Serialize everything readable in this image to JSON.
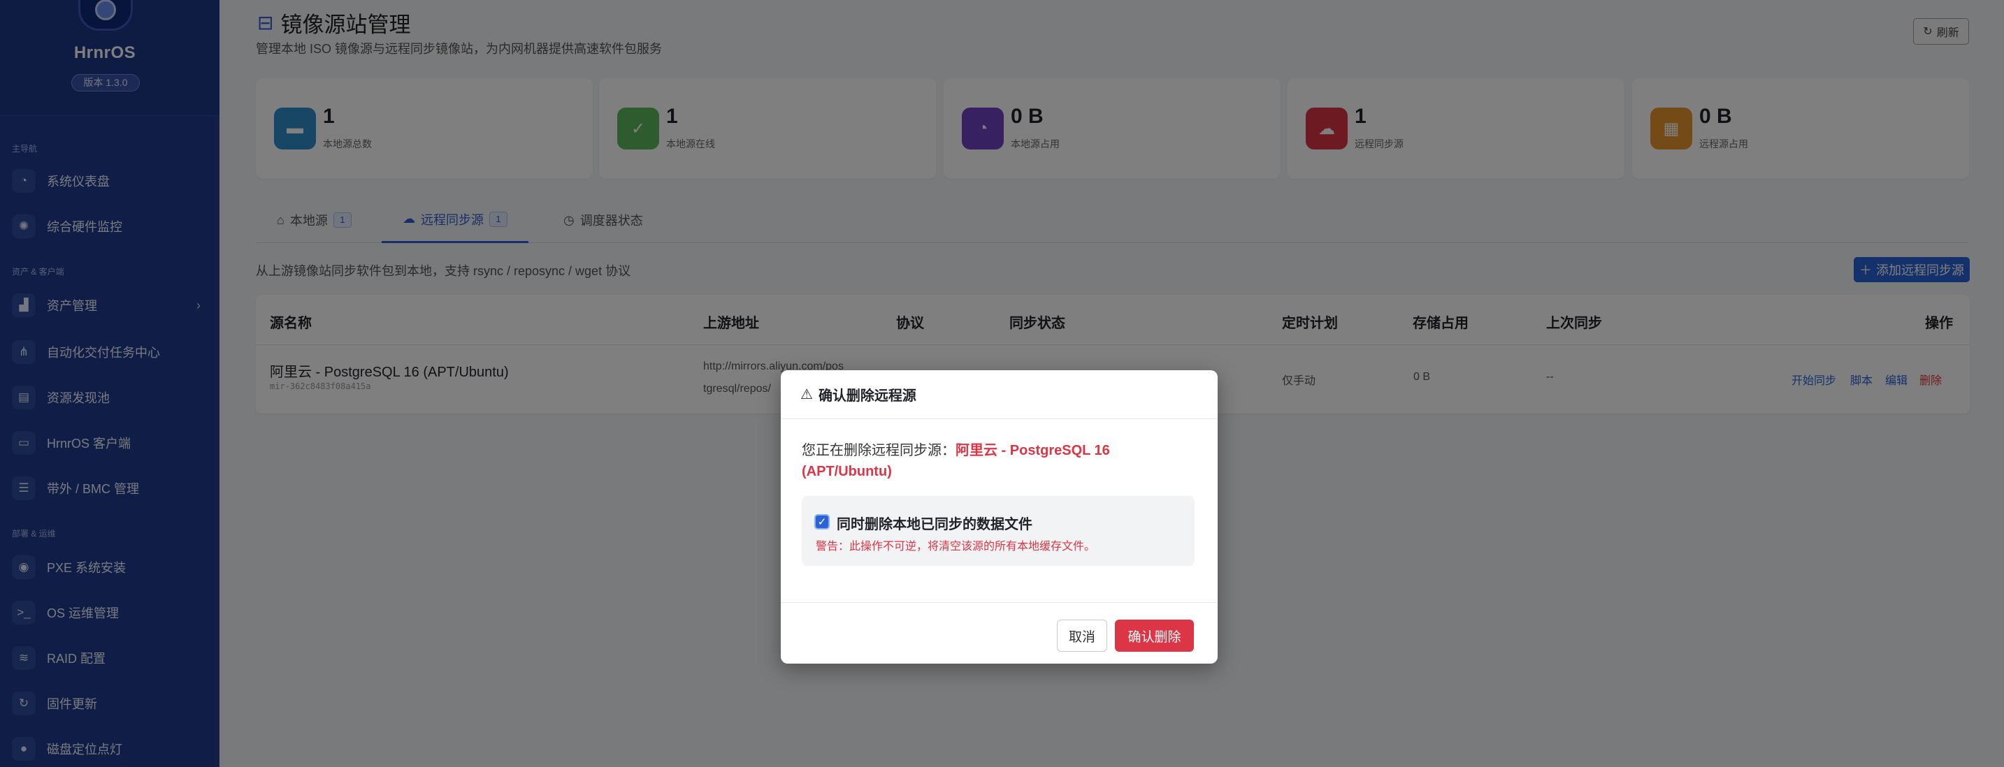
{
  "sidebar": {
    "brand": "HrnrOS",
    "version": "版本 1.3.0",
    "groups": [
      "主导航",
      "资产 & 客户端",
      "部署 & 运维"
    ],
    "items": [
      {
        "label": "系统仪表盘",
        "icon": "dashboard-icon"
      },
      {
        "label": "综合硬件监控",
        "icon": "chip-icon"
      },
      {
        "label": "资产管理",
        "icon": "assets-icon"
      },
      {
        "label": "自动化交付任务中心",
        "icon": "flow-icon"
      },
      {
        "label": "资源发现池",
        "icon": "discovery-icon"
      },
      {
        "label": "HrnrOS 客户端",
        "icon": "laptop-icon"
      },
      {
        "label": "带外 / BMC 管理",
        "icon": "server-icon"
      },
      {
        "label": "PXE 系统安装",
        "icon": "disc-icon"
      },
      {
        "label": "OS 运维管理",
        "icon": "terminal-icon"
      },
      {
        "label": "RAID 配置",
        "icon": "layers-icon"
      },
      {
        "label": "固件更新",
        "icon": "refresh-icon"
      },
      {
        "label": "磁盘定位点灯",
        "icon": "bulb-icon"
      }
    ]
  },
  "header": {
    "title": "镜像源站管理",
    "subtitle": "管理本地 ISO 镜像源与远程同步镜像站，为内网机器提供高速软件包服务",
    "refresh_label": "刷新"
  },
  "stats": [
    {
      "value": "1",
      "label": "本地源总数",
      "color": "#2e8fc9"
    },
    {
      "value": "1",
      "label": "本地源在线",
      "color": "#5cb85c"
    },
    {
      "value": "0 B",
      "label": "本地源占用",
      "color": "#6f42c1"
    },
    {
      "value": "1",
      "label": "远程同步源",
      "color": "#dc3545"
    },
    {
      "value": "0 B",
      "label": "远程源占用",
      "color": "#e8962e"
    }
  ],
  "tabs": [
    {
      "label": "本地源",
      "badge": "1"
    },
    {
      "label": "远程同步源",
      "badge": "1"
    },
    {
      "label": "调度器状态"
    }
  ],
  "hint": "从上游镜像站同步软件包到本地，支持 rsync / reposync / wget 协议",
  "add_label": "添加远程同步源",
  "table": {
    "headers": [
      "源名称",
      "上游地址",
      "协议",
      "同步状态",
      "定时计划",
      "存储占用",
      "上次同步",
      "操作"
    ],
    "row": {
      "name": "阿里云 - PostgreSQL 16 (APT/Ubuntu)",
      "id": "mir-362c8483f08a415a",
      "upstream_1": "http://mirrors.aliyun.com/pos",
      "upstream_2": "tgresql/repos/",
      "schedule": "仅手动",
      "storage": "0 B",
      "last_sync": "--",
      "actions": [
        "开始同步",
        "脚本",
        "编辑",
        "删除"
      ]
    }
  },
  "modal": {
    "title": "确认删除远程源",
    "text_prefix": "您正在删除远程同步源：",
    "target": "阿里云 - PostgreSQL 16 (APT/Ubuntu)",
    "checkbox_label": "同时删除本地已同步的数据文件",
    "warning": "警告：此操作不可逆，将清空该源的所有本地缓存文件。",
    "cancel": "取消",
    "confirm": "确认删除"
  }
}
